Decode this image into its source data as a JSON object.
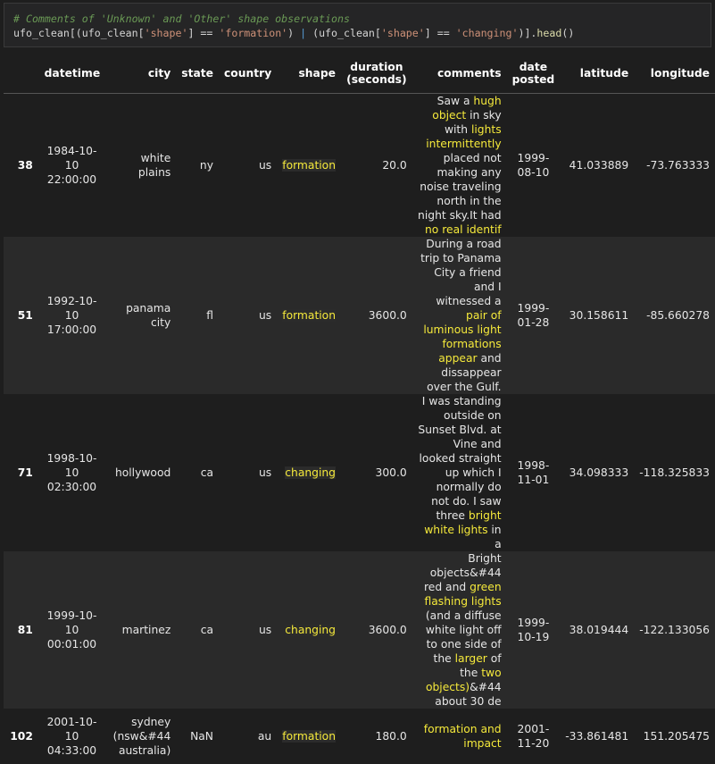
{
  "code": {
    "comment": "# Comments of 'Unknown' and 'Other' shape observations",
    "line2_parts": [
      {
        "t": "ufo_clean[(ufo_clean[",
        "c": "op"
      },
      {
        "t": "'shape'",
        "c": "str"
      },
      {
        "t": "] == ",
        "c": "op"
      },
      {
        "t": "'formation'",
        "c": "str"
      },
      {
        "t": ") ",
        "c": "op"
      },
      {
        "t": "|",
        "c": "pipe"
      },
      {
        "t": " (ufo_clean[",
        "c": "op"
      },
      {
        "t": "'shape'",
        "c": "str"
      },
      {
        "t": "] == ",
        "c": "op"
      },
      {
        "t": "'changing'",
        "c": "str"
      },
      {
        "t": ")].",
        "c": "op"
      },
      {
        "t": "head",
        "c": "fn"
      },
      {
        "t": "()",
        "c": "op"
      }
    ]
  },
  "table": {
    "columns": [
      "",
      "datetime",
      "city",
      "state",
      "country",
      "shape",
      "duration\n(seconds)",
      "comments",
      "date\nposted",
      "latitude",
      "longitude"
    ],
    "rows": [
      {
        "index": "38",
        "datetime": "1984-10-\n10\n22:00:00",
        "city": "white plains",
        "state": "ny",
        "country": "us",
        "shape": "formation",
        "duration": "20.0",
        "comments": [
          {
            "t": "Saw a "
          },
          {
            "t": "hugh object",
            "h": true
          },
          {
            "t": " in sky with "
          },
          {
            "t": "lights intermittently",
            "h": true
          },
          {
            "t": " placed not making any noise traveling north in the night sky.It had "
          },
          {
            "t": "no real identif",
            "h": true
          }
        ],
        "date_posted": "1999-\n08-10",
        "latitude": "41.033889",
        "longitude": "-73.763333"
      },
      {
        "index": "51",
        "datetime": "1992-10-\n10\n17:00:00",
        "city": "panama city",
        "state": "fl",
        "country": "us",
        "shape": "formation",
        "duration": "3600.0",
        "comments": [
          {
            "t": "During a road trip to Panama City a friend and I witnessed a "
          },
          {
            "t": "pair of luminous light formations appear",
            "h": true
          },
          {
            "t": " and dissappear over the Gulf."
          }
        ],
        "date_posted": "1999-\n01-28",
        "latitude": "30.158611",
        "longitude": "-85.660278"
      },
      {
        "index": "71",
        "datetime": "1998-10-\n10\n02:30:00",
        "city": "hollywood",
        "state": "ca",
        "country": "us",
        "shape": "changing",
        "duration": "300.0",
        "comments": [
          {
            "t": "I was standing outside on Sunset Blvd. at Vine and looked straight up which I normally do not do. I saw three "
          },
          {
            "t": "bright white lights",
            "h": true
          },
          {
            "t": " in a"
          }
        ],
        "date_posted": "1998-\n11-01",
        "latitude": "34.098333",
        "longitude": "-118.325833"
      },
      {
        "index": "81",
        "datetime": "1999-10-\n10\n00:01:00",
        "city": "martinez",
        "state": "ca",
        "country": "us",
        "shape": "changing",
        "duration": "3600.0",
        "comments": [
          {
            "t": "Bright objects&#44 red and "
          },
          {
            "t": "green flashing lights",
            "h": true
          },
          {
            "t": " (and a diffuse white light off to one side of the "
          },
          {
            "t": "larger",
            "h": true
          },
          {
            "t": " of the "
          },
          {
            "t": "two objects)",
            "h": true
          },
          {
            "t": "&#44 about 30 de"
          }
        ],
        "date_posted": "1999-\n10-19",
        "latitude": "38.019444",
        "longitude": "-122.133056"
      },
      {
        "index": "102",
        "datetime": "2001-10-\n10\n04:33:00",
        "city": "sydney\n(nsw&#44\naustralia)",
        "state": "NaN",
        "country": "au",
        "shape": "formation",
        "duration": "180.0",
        "comments": [
          {
            "t": "formation and impact",
            "h": true
          }
        ],
        "date_posted": "2001-\n11-20",
        "latitude": "-33.861481",
        "longitude": "151.205475"
      }
    ]
  }
}
